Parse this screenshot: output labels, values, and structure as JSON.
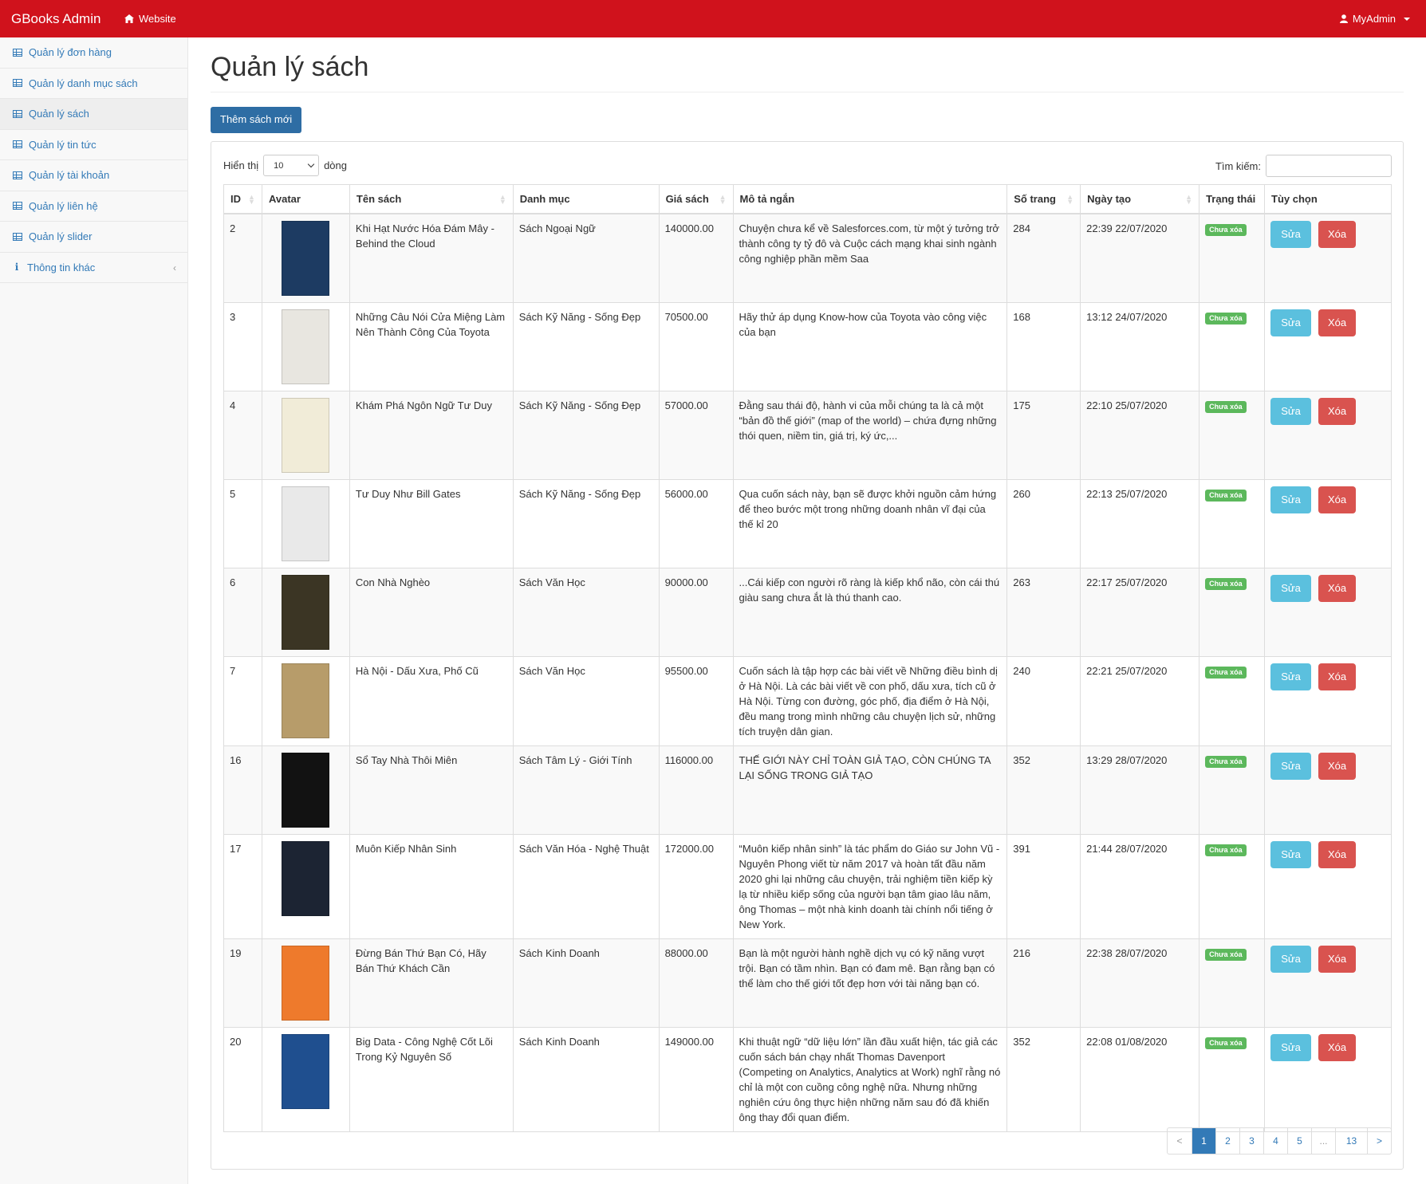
{
  "navbar": {
    "brand": "GBooks Admin",
    "website": "Website",
    "user": "MyAdmin"
  },
  "sidebar": {
    "items": [
      {
        "label": "Quản lý đơn hàng",
        "icon": "table-icon"
      },
      {
        "label": "Quản lý danh mục sách",
        "icon": "table-icon"
      },
      {
        "label": "Quản lý sách",
        "icon": "table-icon",
        "active": true
      },
      {
        "label": "Quản lý tin tức",
        "icon": "table-icon"
      },
      {
        "label": "Quản lý tài khoản",
        "icon": "table-icon"
      },
      {
        "label": "Quản lý liên hệ",
        "icon": "table-icon"
      },
      {
        "label": "Quản lý slider",
        "icon": "table-icon"
      },
      {
        "label": "Thông tin khác",
        "icon": "info-icon"
      }
    ]
  },
  "main": {
    "title": "Quản lý sách",
    "add_button": "Thêm sách mới",
    "show_label": "Hiển thị",
    "page_size": "10",
    "rows_label": "dòng",
    "search_label": "Tìm kiếm:",
    "search_value": ""
  },
  "table": {
    "headers": [
      "ID",
      "Avatar",
      "Tên sách",
      "Danh mục",
      "Giá sách",
      "Mô tả ngắn",
      "Số trang",
      "Ngày tạo",
      "Trạng thái",
      "Tùy chọn"
    ],
    "status_label": "Chưa xóa",
    "edit_label": "Sửa",
    "delete_label": "Xóa",
    "rows": [
      {
        "id": "2",
        "name": "Khi Hạt Nước Hóa Đám Mây - Behind the Cloud",
        "category": "Sách Ngoại Ngữ",
        "price": "140000.00",
        "desc": "Chuyện chưa kể về Salesforces.com, từ một ý tưởng trở thành công ty tỷ đô và Cuộc cách mạng khai sinh ngành công nghiệp phần mềm Saa",
        "pages": "284",
        "created": "22:39 22/07/2020",
        "cover_color": "#1d3b62"
      },
      {
        "id": "3",
        "name": "Những Câu Nói Cửa Miệng Làm Nên Thành Công Của Toyota",
        "category": "Sách Kỹ Năng - Sống Đẹp",
        "price": "70500.00",
        "desc": "Hãy thử áp dụng Know-how của Toyota vào công việc của bạn",
        "pages": "168",
        "created": "13:12 24/07/2020",
        "cover_color": "#e8e6e0"
      },
      {
        "id": "4",
        "name": "Khám Phá Ngôn Ngữ Tư Duy",
        "category": "Sách Kỹ Năng - Sống Đẹp",
        "price": "57000.00",
        "desc": "Đằng sau thái độ, hành vi của mỗi chúng ta là cả một “bản đồ thế giới” (map of the world) – chứa đựng những thói quen, niềm tin, giá trị, ký ức,...",
        "pages": "175",
        "created": "22:10 25/07/2020",
        "cover_color": "#f1ecd8"
      },
      {
        "id": "5",
        "name": "Tư Duy Như Bill Gates",
        "category": "Sách Kỹ Năng - Sống Đẹp",
        "price": "56000.00",
        "desc": "Qua cuốn sách này, bạn sẽ được khởi nguồn cảm hứng để theo bước một trong những doanh nhân vĩ đại của thế kỉ 20",
        "pages": "260",
        "created": "22:13 25/07/2020",
        "cover_color": "#e9e9e9"
      },
      {
        "id": "6",
        "name": "Con Nhà Nghèo",
        "category": "Sách Văn Học",
        "price": "90000.00",
        "desc": "...Cái kiếp con người rõ ràng là kiếp khổ não, còn cái thú giàu sang chưa ắt là thú thanh cao.",
        "pages": "263",
        "created": "22:17 25/07/2020",
        "cover_color": "#3b3524"
      },
      {
        "id": "7",
        "name": "Hà Nội - Dấu Xưa, Phố Cũ",
        "category": "Sách Văn Học",
        "price": "95500.00",
        "desc": "Cuốn sách là tập hợp các bài viết về Những điều bình dị ở Hà Nội. Là các bài viết về con phố, dấu xưa, tích cũ ở Hà Nội. Từng con đường, góc phố, địa điểm ở Hà Nội, đều mang trong mình những câu chuyện lịch sử, những tích truyện dân gian.",
        "pages": "240",
        "created": "22:21 25/07/2020",
        "cover_color": "#b79c6a"
      },
      {
        "id": "16",
        "name": "Sổ Tay Nhà Thôi Miên",
        "category": "Sách Tâm Lý - Giới Tính",
        "price": "116000.00",
        "desc": "THẾ GIỚI NÀY CHỈ TOÀN GIẢ TẠO, CÒN CHÚNG TA LẠI SỐNG TRONG GIẢ TẠO",
        "pages": "352",
        "created": "13:29 28/07/2020",
        "cover_color": "#121212"
      },
      {
        "id": "17",
        "name": "Muôn Kiếp Nhân Sinh",
        "category": "Sách Văn Hóa - Nghệ Thuật",
        "price": "172000.00",
        "desc": "“Muôn kiếp nhân sinh” là tác phẩm do Giáo sư John Vũ - Nguyên Phong viết từ năm 2017 và hoàn tất đầu năm 2020 ghi lại những câu chuyện, trải nghiệm tiền kiếp kỳ lạ từ nhiều kiếp sống của người bạn tâm giao lâu năm, ông Thomas – một nhà kinh doanh tài chính nổi tiếng ở New York.",
        "pages": "391",
        "created": "21:44 28/07/2020",
        "cover_color": "#1c2433"
      },
      {
        "id": "19",
        "name": "Đừng Bán Thứ Bạn Có, Hãy Bán Thứ Khách Cần",
        "category": "Sách Kinh Doanh",
        "price": "88000.00",
        "desc": "Bạn là một người hành nghề dịch vụ có kỹ năng vượt trội. Bạn có tầm nhìn. Bạn có đam mê. Bạn rằng bạn có thể làm cho thế giới tốt đẹp hơn với tài năng bạn có.",
        "pages": "216",
        "created": "22:38 28/07/2020",
        "cover_color": "#ee7a2c"
      },
      {
        "id": "20",
        "name": "Big Data - Công Nghệ Cốt Lõi Trong Kỷ Nguyên Số",
        "category": "Sách Kinh Doanh",
        "price": "149000.00",
        "desc": "Khi thuật ngữ “dữ liệu lớn” lần đầu xuất hiện, tác giả các cuốn sách bán chạy nhất Thomas Davenport (Competing on Analytics, Analytics at Work) nghĩ rằng nó chỉ là một con cuồng công nghệ nữa. Nhưng những nghiên cứu ông thực hiện những năm sau đó đã khiến ông thay đổi quan điểm.",
        "pages": "352",
        "created": "22:08 01/08/2020",
        "cover_color": "#1f4f8f"
      }
    ]
  },
  "pagination": {
    "pages": [
      "<",
      "1",
      "2",
      "3",
      "4",
      "5",
      "...",
      "13",
      ">"
    ],
    "active": "1"
  }
}
